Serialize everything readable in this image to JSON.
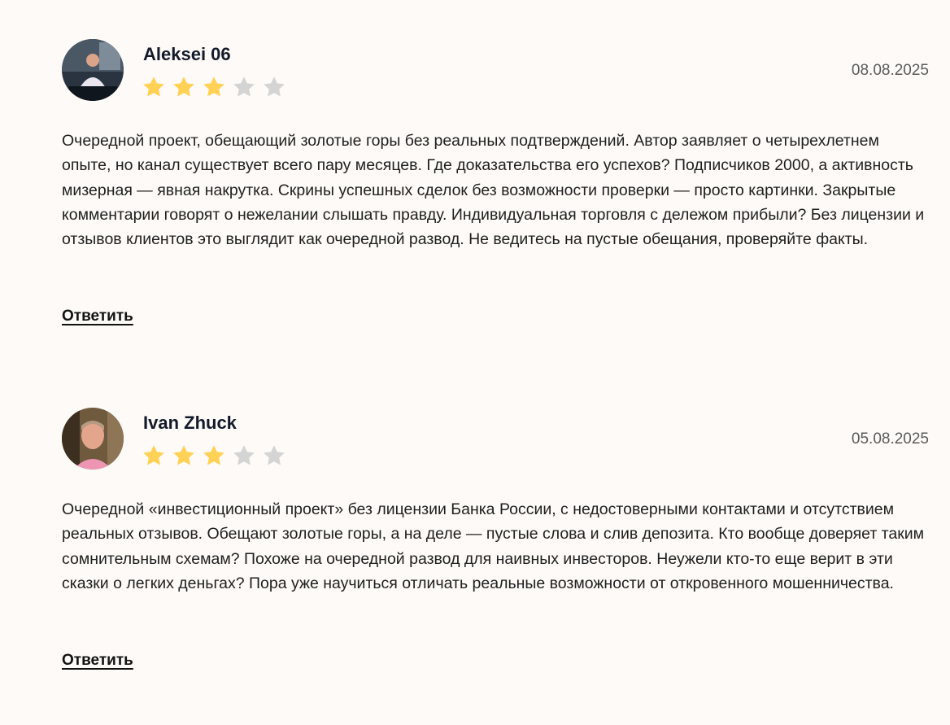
{
  "colors": {
    "background": "#fdfaf7",
    "star_filled": "#ffd155",
    "star_empty": "#d4d4d4",
    "author": "#131a2a"
  },
  "reviews": [
    {
      "author": "Aleksei 06",
      "date": "08.08.2025",
      "rating": 3,
      "max_rating": 5,
      "text": "Очередной проект, обещающий золотые горы без реальных подтверждений. Автор заявляет о четырехлетнем опыте, но канал существует всего пару месяцев. Где доказательства его успехов? Подписчиков 2000, а активность мизерная — явная накрутка. Скрины успешных сделок без возможности проверки — просто картинки. Закрытые комментарии говорят о нежелании слышать правду. Индивидуальная торговля с дележом прибыли? Без лицензии и отзывов клиентов это выглядит как очередной развод. Не ведитесь на пустые обещания, проверяйте факты.",
      "reply_label": "Ответить"
    },
    {
      "author": "Ivan Zhuck",
      "date": "05.08.2025",
      "rating": 3,
      "max_rating": 5,
      "text": "Очередной «инвестиционный проект» без лицензии Банка России, с недостоверными контактами и отсутствием реальных отзывов. Обещают золотые горы, а на деле — пустые слова и слив депозита. Кто вообще доверяет таким сомнительным схемам? Похоже на очередной развод для наивных инвесторов. Неужели кто-то еще верит в эти сказки о легких деньгах? Пора уже научиться отличать реальные возможности от откровенного мошенничества.",
      "reply_label": "Ответить"
    }
  ]
}
